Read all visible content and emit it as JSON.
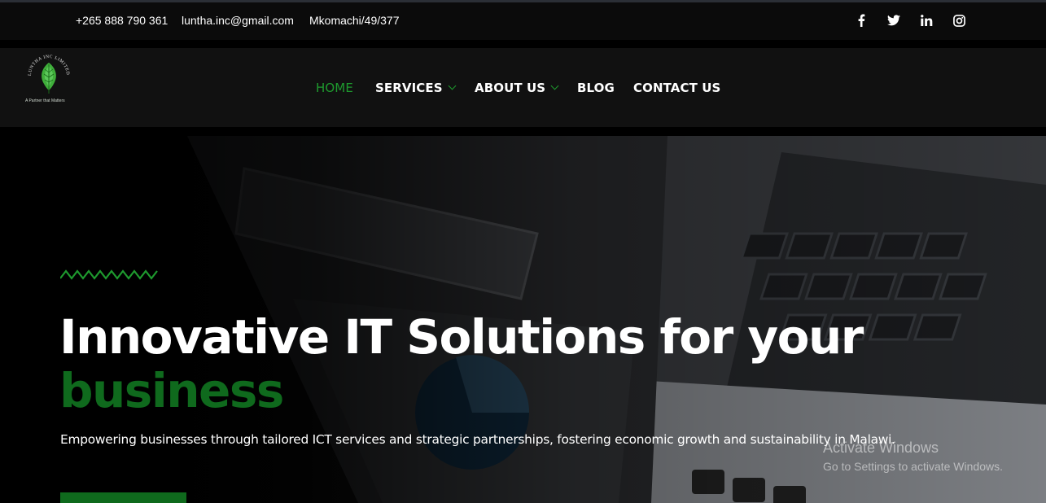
{
  "topbar": {
    "phone": "+265 888 790 361",
    "email": "luntha.inc@gmail.com",
    "address": "Mkomachi/49/377",
    "social": [
      {
        "name": "facebook",
        "glyph": "f"
      },
      {
        "name": "twitter",
        "glyph": "twitter"
      },
      {
        "name": "linkedin",
        "glyph": "in"
      },
      {
        "name": "instagram",
        "glyph": "instagram"
      }
    ]
  },
  "logo": {
    "brand_text": "LUNTHA INC LIMITED",
    "tagline": "A Partner that Matters"
  },
  "nav": {
    "home": "HOME",
    "services": "SERVICES",
    "about": "ABOUT US",
    "blog": "BLOG",
    "contact": "CONTACT US"
  },
  "hero": {
    "title_line1": "Innovative IT Solutions for your",
    "title_line2": "business",
    "subtitle": "Empowering businesses through tailored ICT services and strategic partnerships, fostering economic growth and sustainability in Malawi."
  },
  "windows_watermark": {
    "title": "Activate Windows",
    "subtitle": "Go to Settings to activate Windows."
  },
  "colors": {
    "accent_green": "#1e9a2e",
    "title_green": "#0f6a1d",
    "nav_bg": "#111111"
  }
}
